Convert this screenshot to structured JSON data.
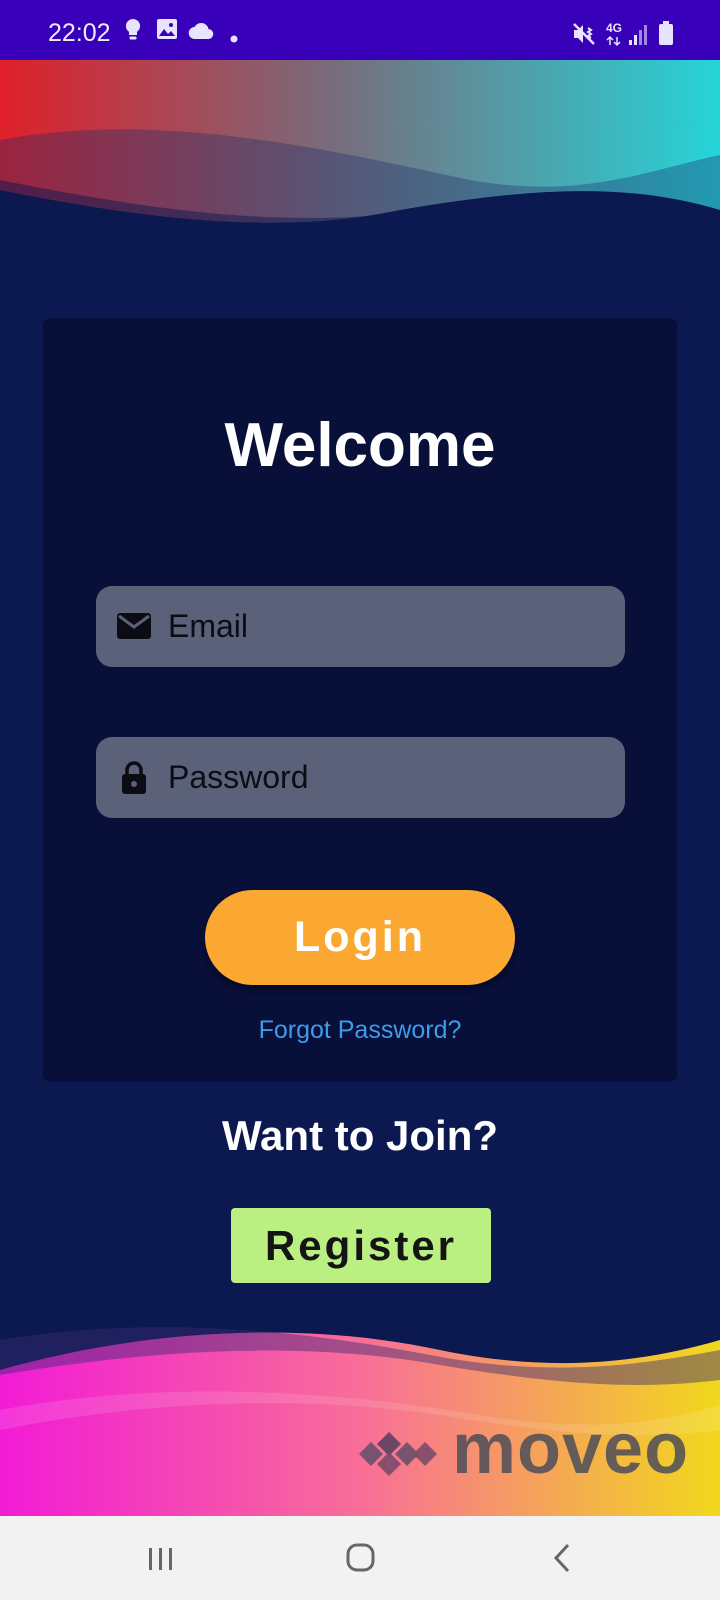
{
  "status_bar": {
    "time": "22:02",
    "network": "4G",
    "icons": [
      "lightbulb-icon",
      "gallery-icon",
      "cloud-icon",
      "dot-icon",
      "mute-vibrate-icon",
      "network-4g-icon",
      "signal-icon",
      "battery-icon"
    ]
  },
  "login": {
    "title": "Welcome",
    "email_placeholder": "Email",
    "password_placeholder": "Password",
    "login_label": "Login",
    "forgot_label": "Forgot Password?"
  },
  "signup": {
    "prompt": "Want to Join?",
    "register_label": "Register"
  },
  "brand": {
    "name": "moveo"
  },
  "nav": {
    "icons": [
      "recents-icon",
      "home-icon",
      "back-icon"
    ]
  },
  "colors": {
    "background": "#0c1850",
    "card": "#080f38",
    "field": "#5b6178",
    "login_button": "#fba832",
    "register_button": "#bcef82",
    "link": "#3d9bea",
    "status_bar": "#3800b8"
  }
}
